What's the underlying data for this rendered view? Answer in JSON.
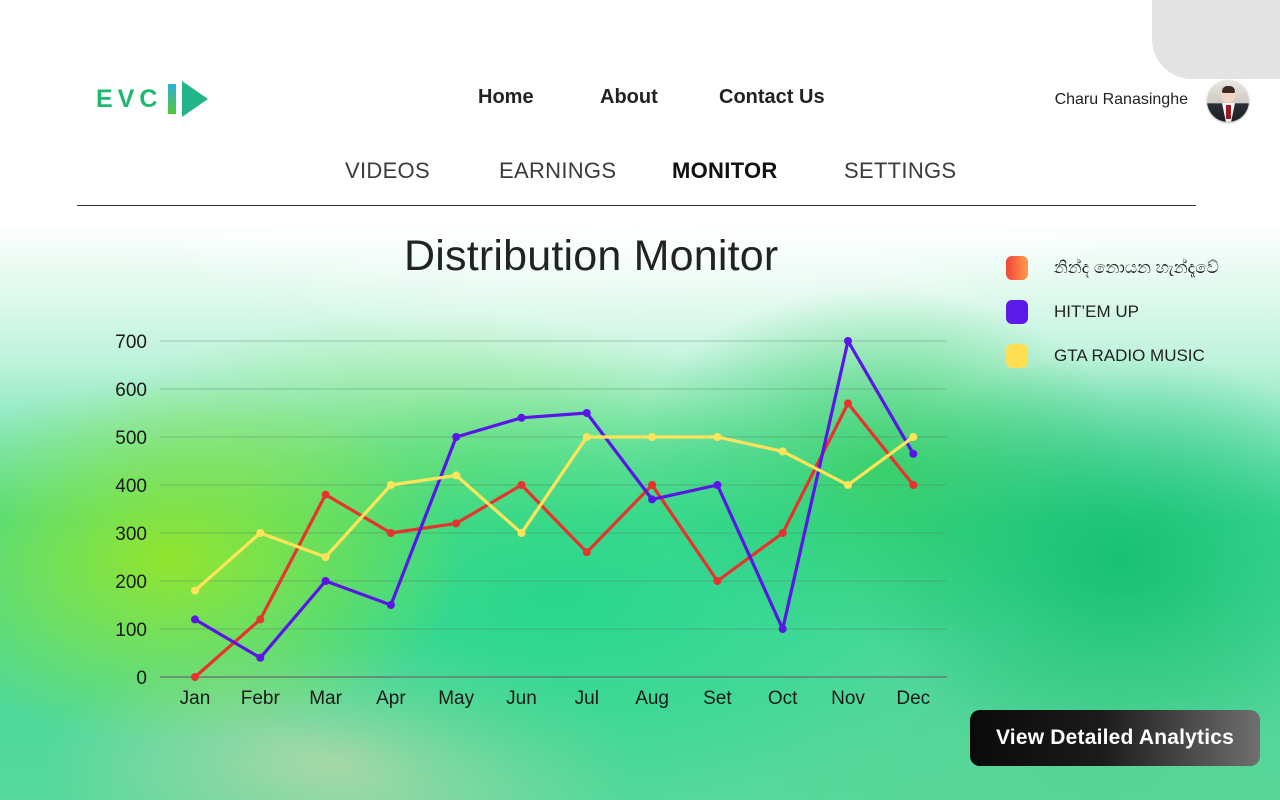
{
  "brand": {
    "logo_text": "EVC"
  },
  "nav": {
    "home": "Home",
    "about": "About",
    "contact": "Contact Us"
  },
  "user": {
    "name": "Charu Ranasinghe"
  },
  "tabs": [
    {
      "label": "VIDEOS",
      "active": false
    },
    {
      "label": "EARNINGS",
      "active": false
    },
    {
      "label": "MONITOR",
      "active": true
    },
    {
      "label": "SETTINGS",
      "active": false
    }
  ],
  "page": {
    "title": "Distribution Monitor"
  },
  "cta": {
    "label": "View Detailed Analytics"
  },
  "legend": [
    {
      "label": "නින්ද නොයන හැන්දෑවේ",
      "color": "#f15a3a"
    },
    {
      "label": "HIT’EM UP",
      "color": "#5b1ae8"
    },
    {
      "label": "GTA RADIO MUSIC",
      "color": "#ffe055"
    }
  ],
  "chart_data": {
    "type": "line",
    "title": "",
    "xlabel": "",
    "ylabel": "",
    "ylim": [
      0,
      700
    ],
    "yticks": [
      0,
      100,
      200,
      300,
      400,
      500,
      600,
      700
    ],
    "grid": true,
    "legend_position": "right",
    "categories": [
      "Jan",
      "Febr",
      "Mar",
      "Apr",
      "May",
      "Jun",
      "Jul",
      "Aug",
      "Set",
      "Oct",
      "Nov",
      "Dec"
    ],
    "series": [
      {
        "name": "නින්ද නොයන හැන්දෑවේ",
        "color": "#e8322c",
        "values": [
          0,
          120,
          380,
          300,
          320,
          400,
          260,
          400,
          200,
          300,
          570,
          400
        ]
      },
      {
        "name": "HIT’EM UP",
        "color": "#5a16e6",
        "values": [
          120,
          40,
          200,
          150,
          500,
          540,
          550,
          370,
          400,
          100,
          700,
          465
        ]
      },
      {
        "name": "GTA RADIO MUSIC",
        "color": "#ffe45a",
        "values": [
          180,
          300,
          250,
          400,
          420,
          300,
          500,
          500,
          500,
          470,
          400,
          500
        ]
      }
    ]
  }
}
